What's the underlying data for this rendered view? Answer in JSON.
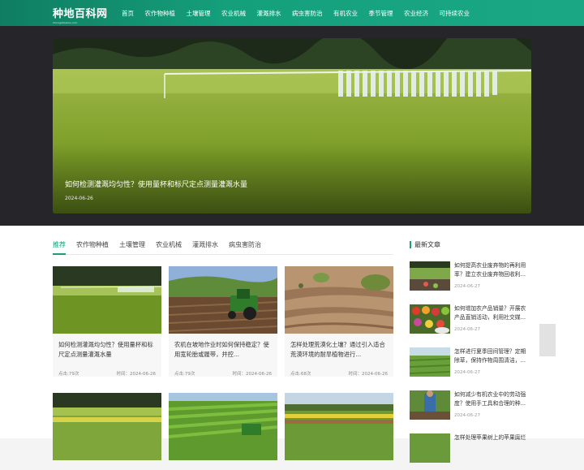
{
  "header": {
    "logo": "种地百科网",
    "logo_sub": "zhongdibaike.com",
    "nav": [
      "首页",
      "农作物种植",
      "土壤管理",
      "农业机械",
      "灌溉排水",
      "病虫害防治",
      "有机农业",
      "季节管理",
      "农业经济",
      "可持续农业"
    ]
  },
  "hero": {
    "title": "如何检测灌溉均匀性？使用量杯和标尺定点测量灌溉水量",
    "date": "2024-06-26"
  },
  "tabs": [
    "推荐",
    "农作物种植",
    "土壤管理",
    "农业机械",
    "灌溉排水",
    "病虫害防治"
  ],
  "cards": [
    {
      "title": "如何检测灌溉均匀性？使用量杯和标尺定点测量灌溉水量",
      "views": "点击:79次",
      "time": "时间：2024-06-26"
    },
    {
      "title": "农机在坡地作业时如何保持稳定？使用宽轮胎或履带，并控...",
      "views": "点击:79次",
      "time": "时间：2024-06-26"
    },
    {
      "title": "怎样处理荒漠化土壤？通过引入适合荒漠环境的耐旱植物进行...",
      "views": "点击:68次",
      "time": "时间：2024-06-26"
    }
  ],
  "sidebar": {
    "heading": "最新文章",
    "items": [
      {
        "title": "如何提高农业废弃物的再利用率？建立农业废弃物回收利...",
        "date": "2024-06-27"
      },
      {
        "title": "如何增加农产品销量？开展农产品直销活动，利用社交媒...",
        "date": "2024-06-27"
      },
      {
        "title": "怎样进行夏季田间管理？定期除草，保持作物周围清洁，...",
        "date": "2024-06-27"
      },
      {
        "title": "如何减少有机农业中的劳动强度？使用手工具和合理的种...",
        "date": "2024-06-27"
      },
      {
        "title": "怎样处理苹果树上的苹果腐烂",
        "date": ""
      }
    ]
  }
}
